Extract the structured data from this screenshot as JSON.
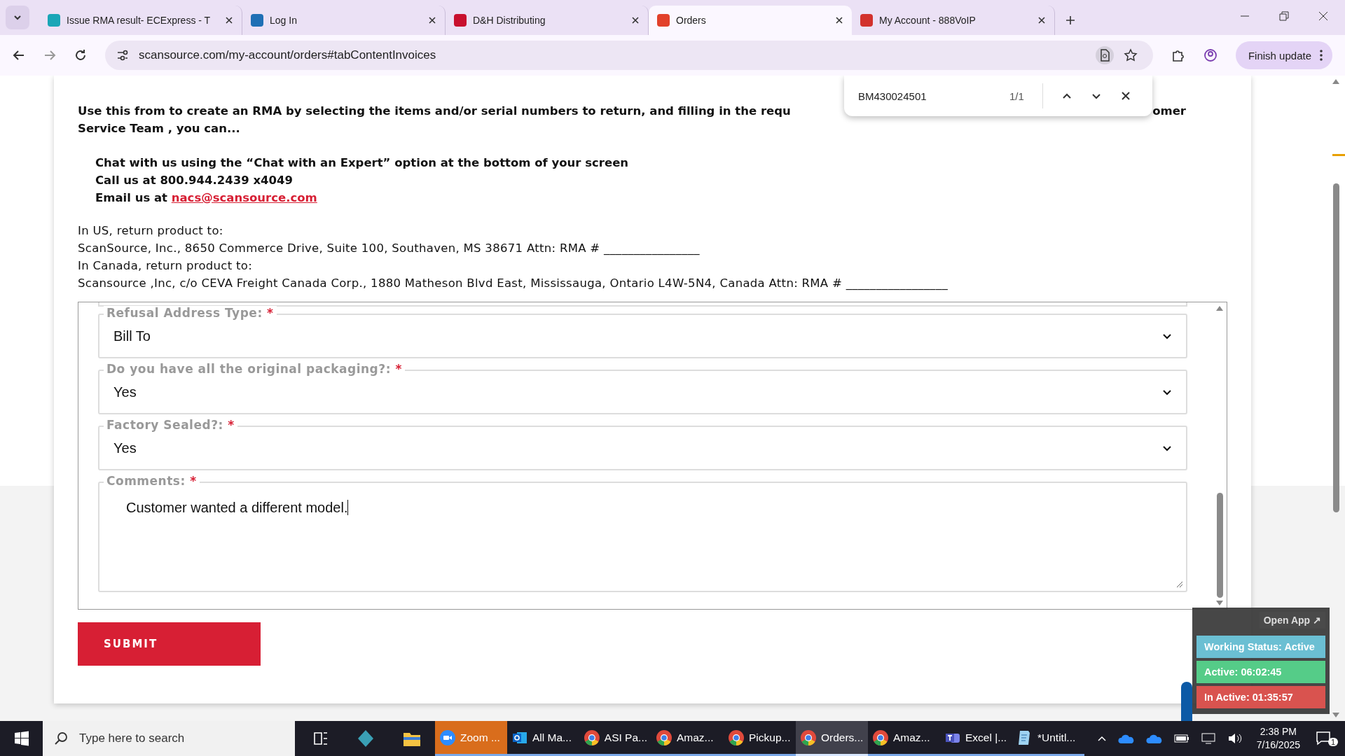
{
  "browser": {
    "tabs": [
      {
        "title": "Issue RMA result- ECExpress - T",
        "selected": false,
        "color": "#1aa6b7"
      },
      {
        "title": "Log In",
        "selected": false,
        "color": "#1f6fb5"
      },
      {
        "title": "D&H Distributing",
        "selected": false,
        "color": "#c8102e"
      },
      {
        "title": "Orders",
        "selected": true,
        "color": "#e2412b"
      },
      {
        "title": "My Account - 888VoIP",
        "selected": false,
        "color": "#d2322d"
      }
    ],
    "url": "scansource.com/my-account/orders#tabContentInvoices",
    "update_button": "Finish update",
    "find_bar": {
      "query": "BM430024501",
      "count": "1/1"
    }
  },
  "intro": {
    "line_start": "Use this from to create an RMA by selecting the items and/or serial numbers to return, and filling in the requ",
    "line_end": "omer",
    "line_2": "Service Team , you can..."
  },
  "contacts": [
    {
      "kind": "text",
      "text": "Chat with us using the “Chat with an Expert” option at the bottom of your screen"
    },
    {
      "kind": "text",
      "text": "Call us at 800.944.2439 x4049"
    },
    {
      "kind": "link",
      "text": "Email us at ",
      "link": "nacs@scansource.com"
    }
  ],
  "addresses": [
    "In US, return product to:",
    "ScanSource, Inc., 8650 Commerce Drive, Suite 100, Southaven, MS 38671 Attn: RMA # ________________",
    "In Canada, return product to:",
    "Scansource ,Inc, c/o CEVA Freight Canada Corp., 1880 Matheson Blvd East, Mississauga, Ontario L4W-5N4, Canada Attn: RMA # _________________"
  ],
  "form_fields": [
    {
      "kind": "select",
      "label": "Refusal Address Type:",
      "required_mark": "*",
      "value": "Bill To"
    },
    {
      "kind": "select",
      "label": "Do you have all the original packaging?:",
      "required_mark": "*",
      "value": "Yes"
    },
    {
      "kind": "select",
      "label": "Factory Sealed?:",
      "required_mark": "*",
      "value": "Yes"
    },
    {
      "kind": "textarea",
      "label": "Comments:",
      "required_mark": "*",
      "value": "Customer wanted a different model."
    }
  ],
  "submit": "SUBMIT",
  "status_widget": {
    "open_app": "Open App ↗",
    "rows": [
      {
        "text": "Working Status: Active",
        "color": "#6bbfd3"
      },
      {
        "text": "Active: 06:02:45",
        "color": "#55cc88"
      },
      {
        "text": "In Active: 01:35:57",
        "color": "#d9534f"
      }
    ]
  },
  "taskbar": {
    "search_placeholder": "Type here to search",
    "apps": [
      {
        "kind": "zoom",
        "label": "Zoom ...",
        "selected": false,
        "flashing": true
      },
      {
        "kind": "outlook",
        "label": "All Ma...",
        "selected": false,
        "flashing": false
      },
      {
        "kind": "chrome",
        "label": "ASI Pa...",
        "selected": false,
        "flashing": false
      },
      {
        "kind": "chrome",
        "label": "Amaz...",
        "selected": false,
        "flashing": false
      },
      {
        "kind": "chrome",
        "label": "Pickup...",
        "selected": false,
        "flashing": false
      },
      {
        "kind": "chrome",
        "label": "Orders...",
        "selected": true,
        "flashing": false
      },
      {
        "kind": "chrome",
        "label": "Amaz...",
        "selected": false,
        "flashing": false
      },
      {
        "kind": "teams",
        "label": "Excel |...",
        "selected": false,
        "flashing": false
      },
      {
        "kind": "notepad",
        "label": "*Untitl...",
        "selected": false,
        "flashing": false
      }
    ],
    "time": "2:38 PM",
    "date": "7/16/2025",
    "notifications": "1"
  }
}
